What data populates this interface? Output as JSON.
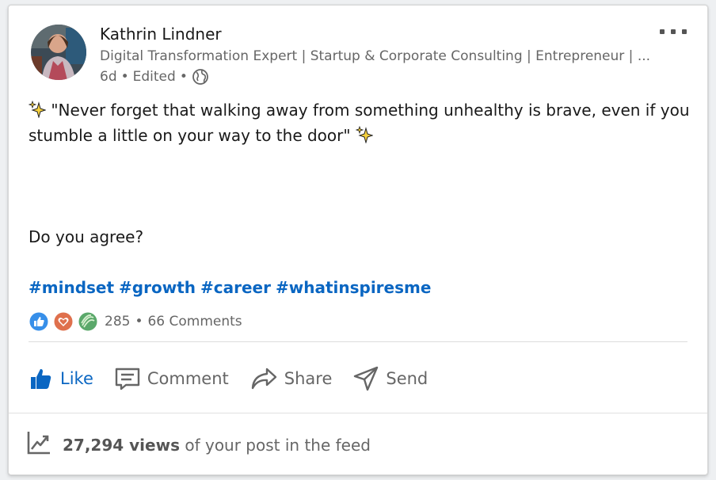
{
  "author": {
    "name": "Kathrin Lindner",
    "headline": "Digital Transformation Expert | Startup & Corporate Consulting | Entrepreneur | ...",
    "time_ago": "6d",
    "edited": "Edited",
    "separator": "•",
    "visibility_icon": "globe-icon"
  },
  "post": {
    "quote": "\"Never forget that walking away from something unhealthy is brave, even if you stumble a little on your way to the door\"",
    "question": "Do you agree?",
    "hashtags": [
      "#mindset",
      "#growth",
      "#career",
      "#whatinspiresme"
    ]
  },
  "social": {
    "reactions": [
      "like-reaction-icon",
      "love-reaction-icon",
      "insightful-reaction-icon"
    ],
    "reaction_count": "285",
    "dot": "•",
    "comments": "66 Comments"
  },
  "actions": {
    "like": "Like",
    "comment": "Comment",
    "share": "Share",
    "send": "Send"
  },
  "analytics": {
    "views_count": "27,294 views",
    "views_suffix": "of your post in the feed"
  },
  "colors": {
    "accent": "#0a66c2",
    "muted_text": "#666666",
    "love": "#df704d",
    "insightful": "#5aa86a"
  }
}
